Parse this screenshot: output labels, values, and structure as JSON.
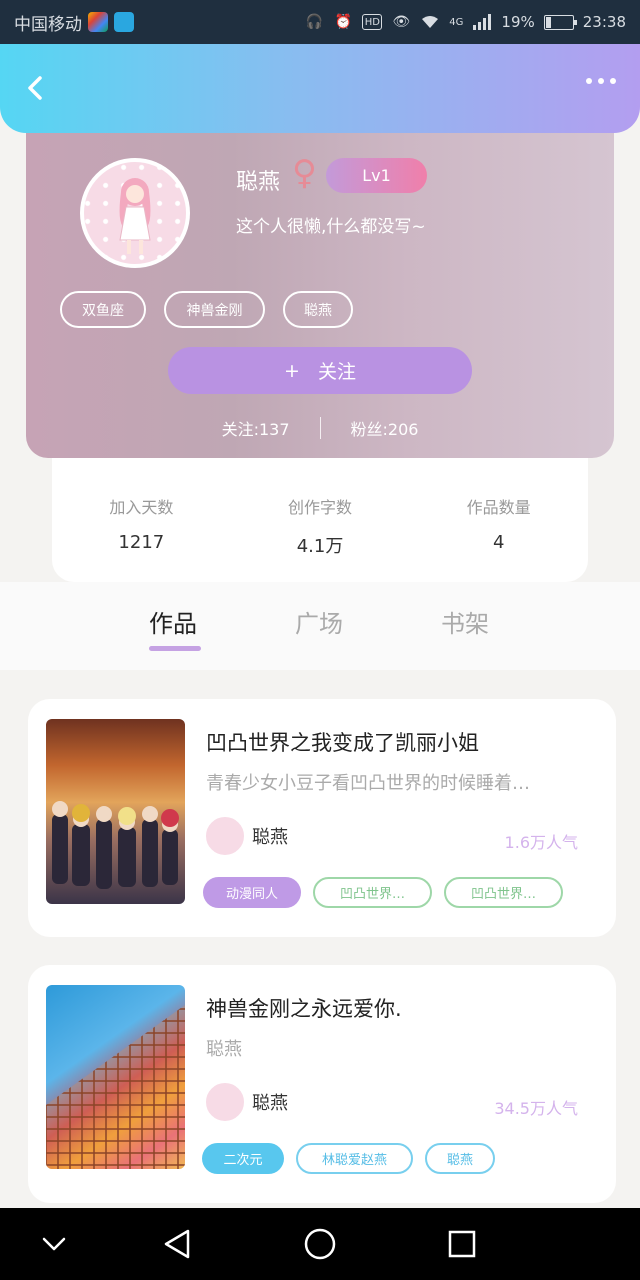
{
  "status_bar": {
    "carrier": "中国移动",
    "signal": "4G",
    "battery": "19%",
    "battery_level": 0.19,
    "time": "23:38"
  },
  "header": {
    "back_icon": "chevron-left-icon",
    "more_icon": "more-dots-icon",
    "accent_gradient": [
      "#55d6f3",
      "#b39ef0"
    ]
  },
  "profile": {
    "name": "聪燕",
    "gender_symbol": "♀",
    "level": "Lv1",
    "bio": "这个人很懒,什么都没写~",
    "tags": [
      "双鱼座",
      "神兽金刚",
      "聪燕"
    ],
    "follow_button": {
      "plus": "+",
      "label": "关注"
    },
    "following_label": "关注:137",
    "fans_label": "粉丝:206"
  },
  "stats": [
    {
      "label": "加入天数",
      "value": "1217"
    },
    {
      "label": "创作字数",
      "value": "4.1万"
    },
    {
      "label": "作品数量",
      "value": "4"
    }
  ],
  "tabs": [
    {
      "label": "作品",
      "active": true
    },
    {
      "label": "广场",
      "active": false
    },
    {
      "label": "书架",
      "active": false
    }
  ],
  "works": [
    {
      "title": "凹凸世界之我变成了凯丽小姐",
      "description": "青春少女小豆子看凹凸世界的时候睡着…",
      "author": "聪燕",
      "popularity": "1.6万人气",
      "tags": [
        {
          "label": "动漫同人",
          "style": "fill-purple"
        },
        {
          "label": "凹凸世界…",
          "style": "out-green"
        },
        {
          "label": "凹凸世界…",
          "style": "out-green"
        }
      ]
    },
    {
      "title": "神兽金刚之永远爱你.",
      "description": "聪燕",
      "author": "聪燕",
      "popularity": "34.5万人气",
      "tags": [
        {
          "label": "二次元",
          "style": "fill-cyan"
        },
        {
          "label": "林聪爱赵燕",
          "style": "out-cyan"
        },
        {
          "label": "聪燕",
          "style": "out-cyan"
        }
      ]
    }
  ],
  "nav_bar": {
    "icons": [
      "chevron-down-icon",
      "back-triangle-icon",
      "home-circle-icon",
      "recents-square-icon"
    ]
  }
}
